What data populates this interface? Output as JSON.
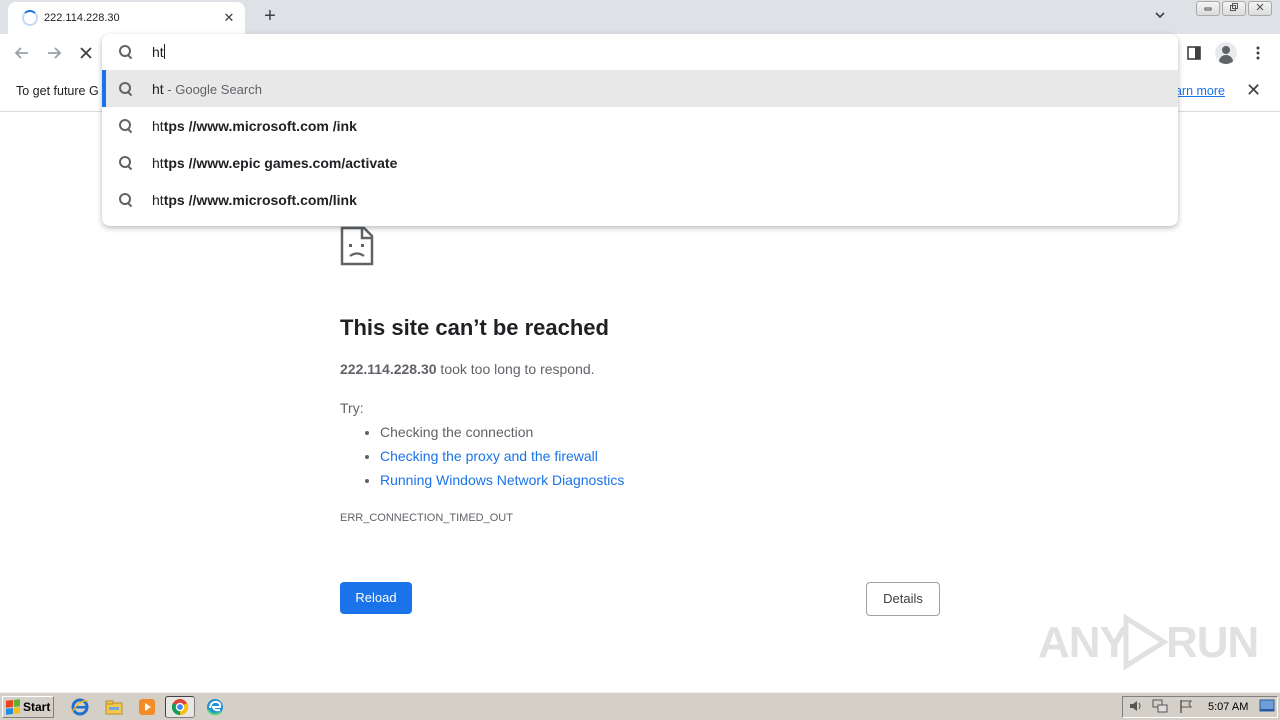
{
  "browser": {
    "tab_title": "222.114.228.30",
    "tab_close_glyph": "✕",
    "new_tab_glyph": "+",
    "tab_search_glyph": "⌄"
  },
  "omnibox": {
    "typed_prefix": "ht",
    "suggestions": [
      {
        "match": "ht",
        "rest": "",
        "suffix": " - Google Search",
        "selected": true
      },
      {
        "match": "ht",
        "rest": "tps //www.microsoft.com /ink",
        "suffix": "",
        "selected": false
      },
      {
        "match": "ht",
        "rest": "tps //www.epic games.com/activate",
        "suffix": "",
        "selected": false
      },
      {
        "match": "ht",
        "rest": "tps //www.microsoft.com/link",
        "suffix": "",
        "selected": false
      }
    ]
  },
  "infobar": {
    "text": "To get future G",
    "link": "earn more",
    "close_glyph": "✕"
  },
  "error": {
    "title": "This site can’t be reached",
    "host": "222.114.228.30",
    "message": " took too long to respond.",
    "try_label": "Try:",
    "suggestions": [
      {
        "text": "Checking the connection",
        "link": false
      },
      {
        "text": "Checking the proxy and the firewall",
        "link": true
      },
      {
        "text": "Running Windows Network Diagnostics",
        "link": true
      }
    ],
    "code": "ERR_CONNECTION_TIMED_OUT",
    "reload_label": "Reload",
    "details_label": "Details"
  },
  "watermark": {
    "left": "ANY",
    "right": "RUN"
  },
  "taskbar": {
    "start_label": "Start",
    "clock": "5:07 AM"
  },
  "colors": {
    "accent": "#1a73e8",
    "taskbar": "#d4d0c8",
    "tabstrip": "#dee1e6"
  }
}
